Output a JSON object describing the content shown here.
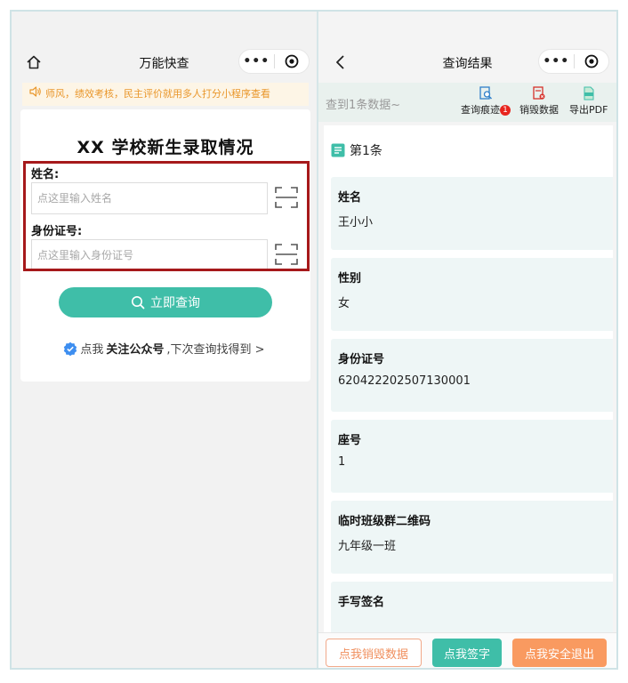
{
  "left": {
    "nav_title": "万能快查",
    "capsule_dots": "•••",
    "notice": "师风，绩效考核，民主评价就用多人打分小程序查看",
    "title": "XX 学校新生录取情况",
    "name_label": "姓名:",
    "name_placeholder": "点这里输入姓名",
    "id_label": "身份证号:",
    "id_placeholder": "点这里输入身份证号",
    "query_button": "立即查询",
    "follow_prefix": "点我",
    "follow_bold": "关注公众号",
    "follow_suffix": ",下次查询找得到 >"
  },
  "right": {
    "nav_title": "查询结果",
    "capsule_dots": "•••",
    "count_text": "查到1条数据~",
    "tools": [
      {
        "label": "查询痕迹",
        "badge": "1"
      },
      {
        "label": "销毁数据"
      },
      {
        "label": "导出PDF"
      }
    ],
    "item_title": "第1条",
    "fields": [
      {
        "label": "姓名",
        "value": "王小小"
      },
      {
        "label": "性别",
        "value": "女"
      },
      {
        "label": "身份证号",
        "value": "620422202507130001"
      },
      {
        "label": "座号",
        "value": "1"
      },
      {
        "label": "临时班级群二维码",
        "value": "九年级一班"
      },
      {
        "label": "手写签名",
        "value": ""
      }
    ],
    "bottom_buttons": {
      "destroy": "点我销毁数据",
      "sign": "点我签字",
      "exit": "点我安全退出"
    }
  },
  "colors": {
    "accent": "#3fbea8",
    "highlight_box": "#a6191b",
    "notice_text": "#e9962a",
    "badge": "#e8251e",
    "exit_button": "#f99a60"
  }
}
